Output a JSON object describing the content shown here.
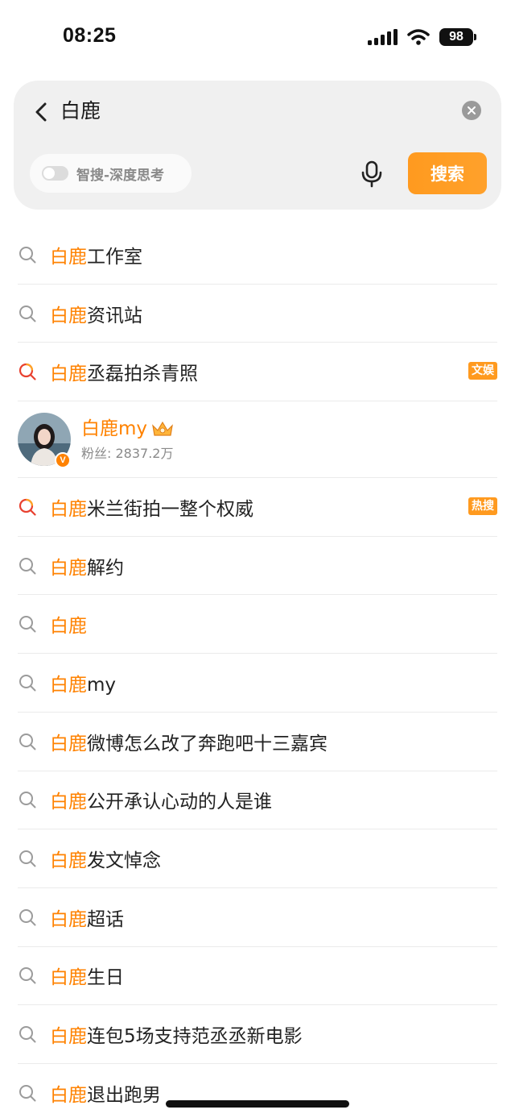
{
  "status": {
    "time": "08:25",
    "battery": "98"
  },
  "search": {
    "query": "白鹿",
    "ai_toggle_label": "智搜-深度思考",
    "search_button": "搜索"
  },
  "suggestions_top": [
    {
      "highlight": "白鹿",
      "rest": "工作室",
      "icon": "search-icon"
    },
    {
      "highlight": "白鹿",
      "rest": "资讯站",
      "icon": "search-icon"
    },
    {
      "highlight": "白鹿",
      "rest": "丞磊拍杀青照",
      "icon": "hot-search-icon",
      "tag": "文娱"
    }
  ],
  "user": {
    "name": "白鹿my",
    "fans": "粉丝: 2837.2万",
    "verified": "V"
  },
  "suggestions": [
    {
      "highlight": "白鹿",
      "rest": "米兰街拍一整个权威",
      "icon": "hot-search-icon",
      "tag": "热搜"
    },
    {
      "highlight": "白鹿",
      "rest": "解约",
      "icon": "search-icon"
    },
    {
      "highlight": "白鹿",
      "rest": "",
      "icon": "search-icon"
    },
    {
      "highlight": "白鹿",
      "rest": "my",
      "icon": "search-icon"
    },
    {
      "highlight": "白鹿",
      "rest": "微博怎么改了奔跑吧十三嘉宾",
      "icon": "search-icon"
    },
    {
      "highlight": "白鹿",
      "rest": "公开承认心动的人是谁",
      "icon": "search-icon"
    },
    {
      "highlight": "白鹿",
      "rest": "发文悼念",
      "icon": "search-icon"
    },
    {
      "highlight": "白鹿",
      "rest": "超话",
      "icon": "search-icon"
    },
    {
      "highlight": "白鹿",
      "rest": "生日",
      "icon": "search-icon"
    },
    {
      "highlight": "白鹿",
      "rest": "连包5场支持范丞丞新电影",
      "icon": "search-icon"
    },
    {
      "highlight": "白鹿",
      "rest": "退出跑男",
      "icon": "search-icon"
    }
  ],
  "colors": {
    "accent": "#ff8200",
    "button": "#ff9a1f",
    "card": "#f0f0f0"
  }
}
